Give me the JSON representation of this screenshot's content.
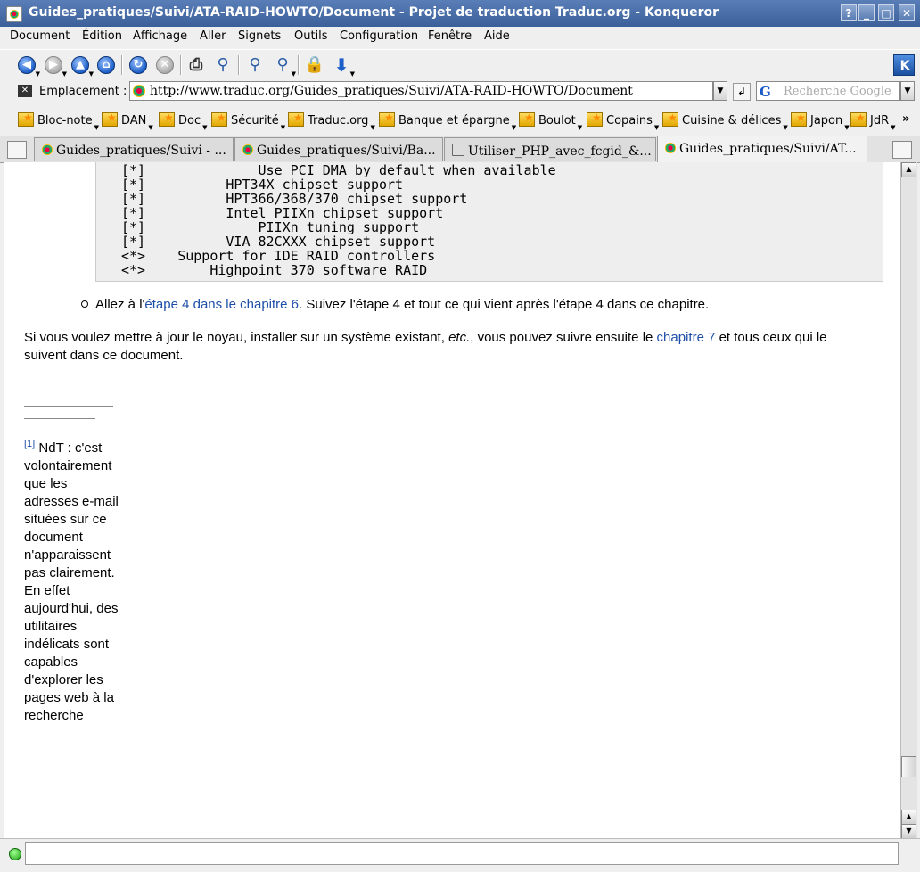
{
  "window": {
    "title": "Guides_pratiques/Suivi/ATA-RAID-HOWTO/Document - Projet de traduction Traduc.org - Konqueror",
    "buttons": [
      "?",
      "_",
      "□",
      "✕"
    ]
  },
  "menubar": {
    "items": [
      "Document",
      "Édition",
      "Affichage",
      "Aller",
      "Signets",
      "Outils",
      "Configuration",
      "Fenêtre",
      "Aide"
    ]
  },
  "location": {
    "label": "Emplacement :",
    "url": "http://www.traduc.org/Guides_pratiques/Suivi/ATA-RAID-HOWTO/Document",
    "search_placeholder": "Recherche Google",
    "search_engine_glyph": "G"
  },
  "bookmarks": {
    "items": [
      "Bloc-note",
      "DAN",
      "Doc",
      "Sécurité",
      "Traduc.org",
      "Banque et épargne",
      "Boulot",
      "Copains",
      "Cuisine & délices",
      "Japon",
      "JdR"
    ],
    "overflow": "»"
  },
  "tabs": [
    {
      "label": "Guides_pratiques/Suivi - ..."
    },
    {
      "label": "Guides_pratiques/Suivi/Ba..."
    },
    {
      "label": "Utiliser_PHP_avec_fcgid_&..."
    },
    {
      "label": "Guides_pratiques/Suivi/AT..."
    }
  ],
  "content": {
    "pre_lines": [
      "[*]              Use PCI DMA by default when available",
      "[*]          HPT34X chipset support",
      "[*]          HPT366/368/370 chipset support",
      "[*]          Intel PIIXn chipset support",
      "[*]              PIIXn tuning support",
      "[*]          VIA 82CXXX chipset support",
      "<*>    Support for IDE RAID controllers",
      "<*>        Highpoint 370 software RAID"
    ],
    "bullet": {
      "before": "Allez à l'",
      "link": "étape 4 dans le chapitre 6",
      "after": ". Suivez l'étape 4 et tout ce qui vient après l'étape 4 dans ce chapitre."
    },
    "paragraph": {
      "before": "Si vous voulez mettre à jour le noyau, installer sur un système existant, ",
      "italic": "etc.",
      "middle": ", vous pouvez suivre ensuite le ",
      "link": "chapitre 7",
      "after": " et tous ceux qui le suivent dans ce document."
    },
    "footnote": {
      "mark": "[1]",
      "text": " NdT : c'est volontairement que les adresses e-mail situées sur ce document n'apparaissent pas clairement. En effet aujourd'hui, des utilitaires indélicats sont capables d'explorer les pages web à la recherche"
    }
  },
  "colors": {
    "title_bar": "#3b5f9a",
    "link": "#1e4ea8",
    "pre_background": "#eeeeee"
  }
}
